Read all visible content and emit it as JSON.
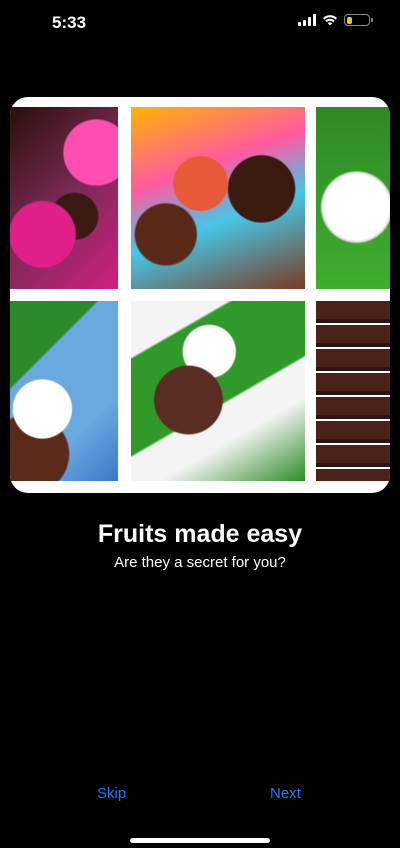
{
  "status_bar": {
    "time": "5:33",
    "battery_level": 0.25,
    "battery_color": "#f5c518",
    "icons": [
      "signal-icon",
      "wifi-icon",
      "battery-icon"
    ]
  },
  "onboarding": {
    "title": "Fruits made easy",
    "subtitle": "Are they a secret for you?",
    "images": [
      "chocolate-pink-fruit",
      "colorful-fruit-mix",
      "white-fluffy-fruit",
      "fluffy-fruit-blue-leaf",
      "brown-fruit-green-leaf",
      "stacked-brown-slices"
    ]
  },
  "nav": {
    "skip_label": "Skip",
    "next_label": "Next",
    "accent": "#1a7cf5"
  }
}
